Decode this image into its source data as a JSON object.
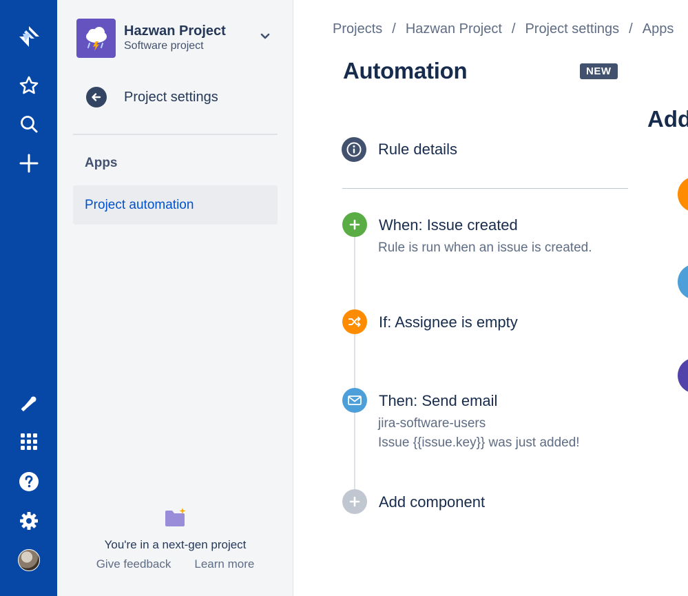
{
  "global_nav": {
    "items": [
      "jira-logo",
      "starred",
      "search",
      "create",
      "whats-new",
      "app-switcher",
      "help",
      "settings",
      "profile"
    ]
  },
  "project": {
    "name": "Hazwan Project",
    "type": "Software project",
    "avatar_color": "#6554c0"
  },
  "sidebar": {
    "back_label": "Project settings",
    "section_title": "Apps",
    "active_item": "Project automation",
    "footer": {
      "text": "You're in a next-gen project",
      "feedback": "Give feedback",
      "learn_more": "Learn more"
    }
  },
  "breadcrumbs": [
    "Projects",
    "Hazwan Project",
    "Project settings",
    "Apps"
  ],
  "page": {
    "title": "Automation",
    "badge": "NEW"
  },
  "rule": {
    "details_label": "Rule details",
    "components": [
      {
        "kind": "trigger",
        "title": "When: Issue created",
        "desc": [
          "Rule is run when an issue is created."
        ],
        "color": "#5aac44"
      },
      {
        "kind": "condition",
        "title": "If: Assignee is empty",
        "desc": [],
        "color": "#ff8b00"
      },
      {
        "kind": "action",
        "title": "Then: Send email",
        "desc": [
          "jira-software-users",
          "Issue {{issue.key}} was just added!"
        ],
        "color": "#4c9fd9"
      },
      {
        "kind": "add",
        "title": "Add component",
        "desc": [],
        "color": "#c1c7d0"
      }
    ]
  },
  "right_panel": {
    "heading": "Add",
    "circle_colors": [
      "#ff8b00",
      "#4c9fd9",
      "#5243aa"
    ]
  },
  "colors": {
    "nav_blue": "#0747a6",
    "sidebar_bg": "#f4f5f7",
    "link_blue": "#0052cc"
  }
}
